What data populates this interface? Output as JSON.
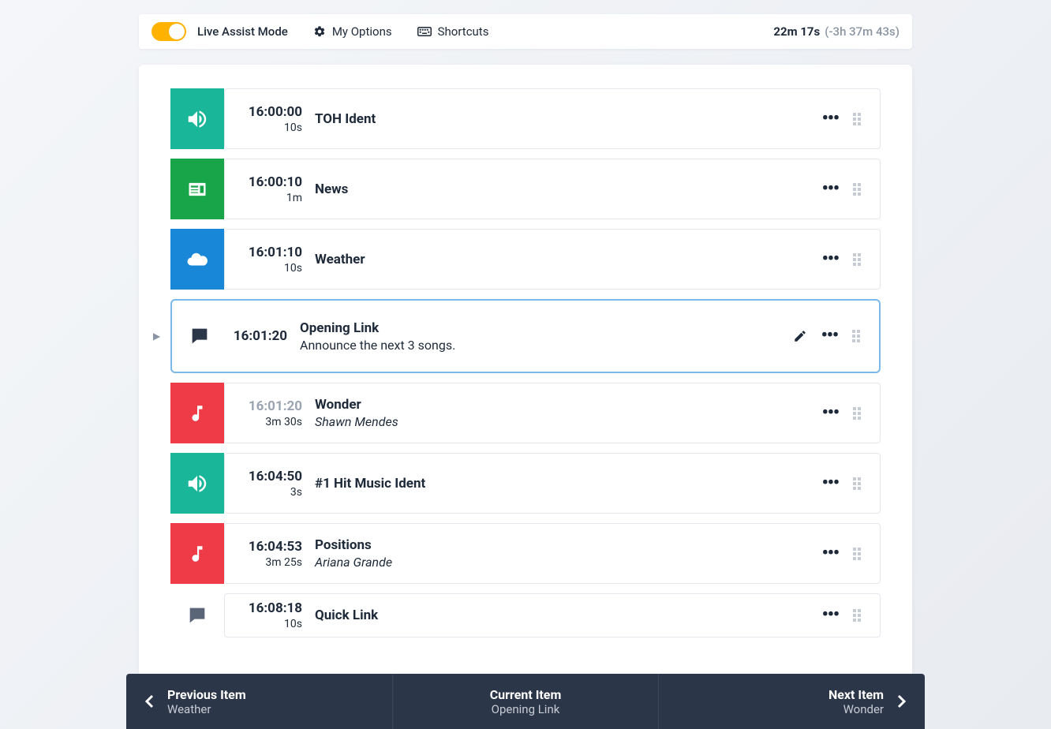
{
  "topbar": {
    "mode_label": "Live Assist Mode",
    "options_label": "My Options",
    "shortcuts_label": "Shortcuts",
    "elapsed": "22m 17s",
    "diff": "(-3h 37m 43s)"
  },
  "items": [
    {
      "time": "16:00:00",
      "dur": "10s",
      "title": "TOH Ident",
      "sub": "",
      "icon": "speaker",
      "color": "teal"
    },
    {
      "time": "16:00:10",
      "dur": "1m",
      "title": "News",
      "sub": "",
      "icon": "news",
      "color": "green"
    },
    {
      "time": "16:01:10",
      "dur": "10s",
      "title": "Weather",
      "sub": "",
      "icon": "cloud",
      "color": "blue"
    },
    {
      "time": "16:01:20",
      "dur": "",
      "title": "Opening Link",
      "sub": "Announce the next 3 songs.",
      "icon": "speech",
      "current": true
    },
    {
      "time": "16:01:20",
      "dur": "3m 30s",
      "title": "Wonder",
      "sub": "Shawn Mendes",
      "icon": "music",
      "color": "red",
      "muted_time": true,
      "italic_sub": true
    },
    {
      "time": "16:04:50",
      "dur": "3s",
      "title": "#1 Hit Music Ident",
      "sub": "",
      "icon": "speaker",
      "color": "teal"
    },
    {
      "time": "16:04:53",
      "dur": "3m 25s",
      "title": "Positions",
      "sub": "Ariana Grande",
      "icon": "music",
      "color": "red",
      "italic_sub": true
    },
    {
      "time": "16:08:18",
      "dur": "10s",
      "title": "Quick Link",
      "sub": "",
      "icon": "speech-gray"
    }
  ],
  "nav": {
    "prev_label": "Previous Item",
    "prev_value": "Weather",
    "curr_label": "Current Item",
    "curr_value": "Opening Link",
    "next_label": "Next Item",
    "next_value": "Wonder"
  }
}
